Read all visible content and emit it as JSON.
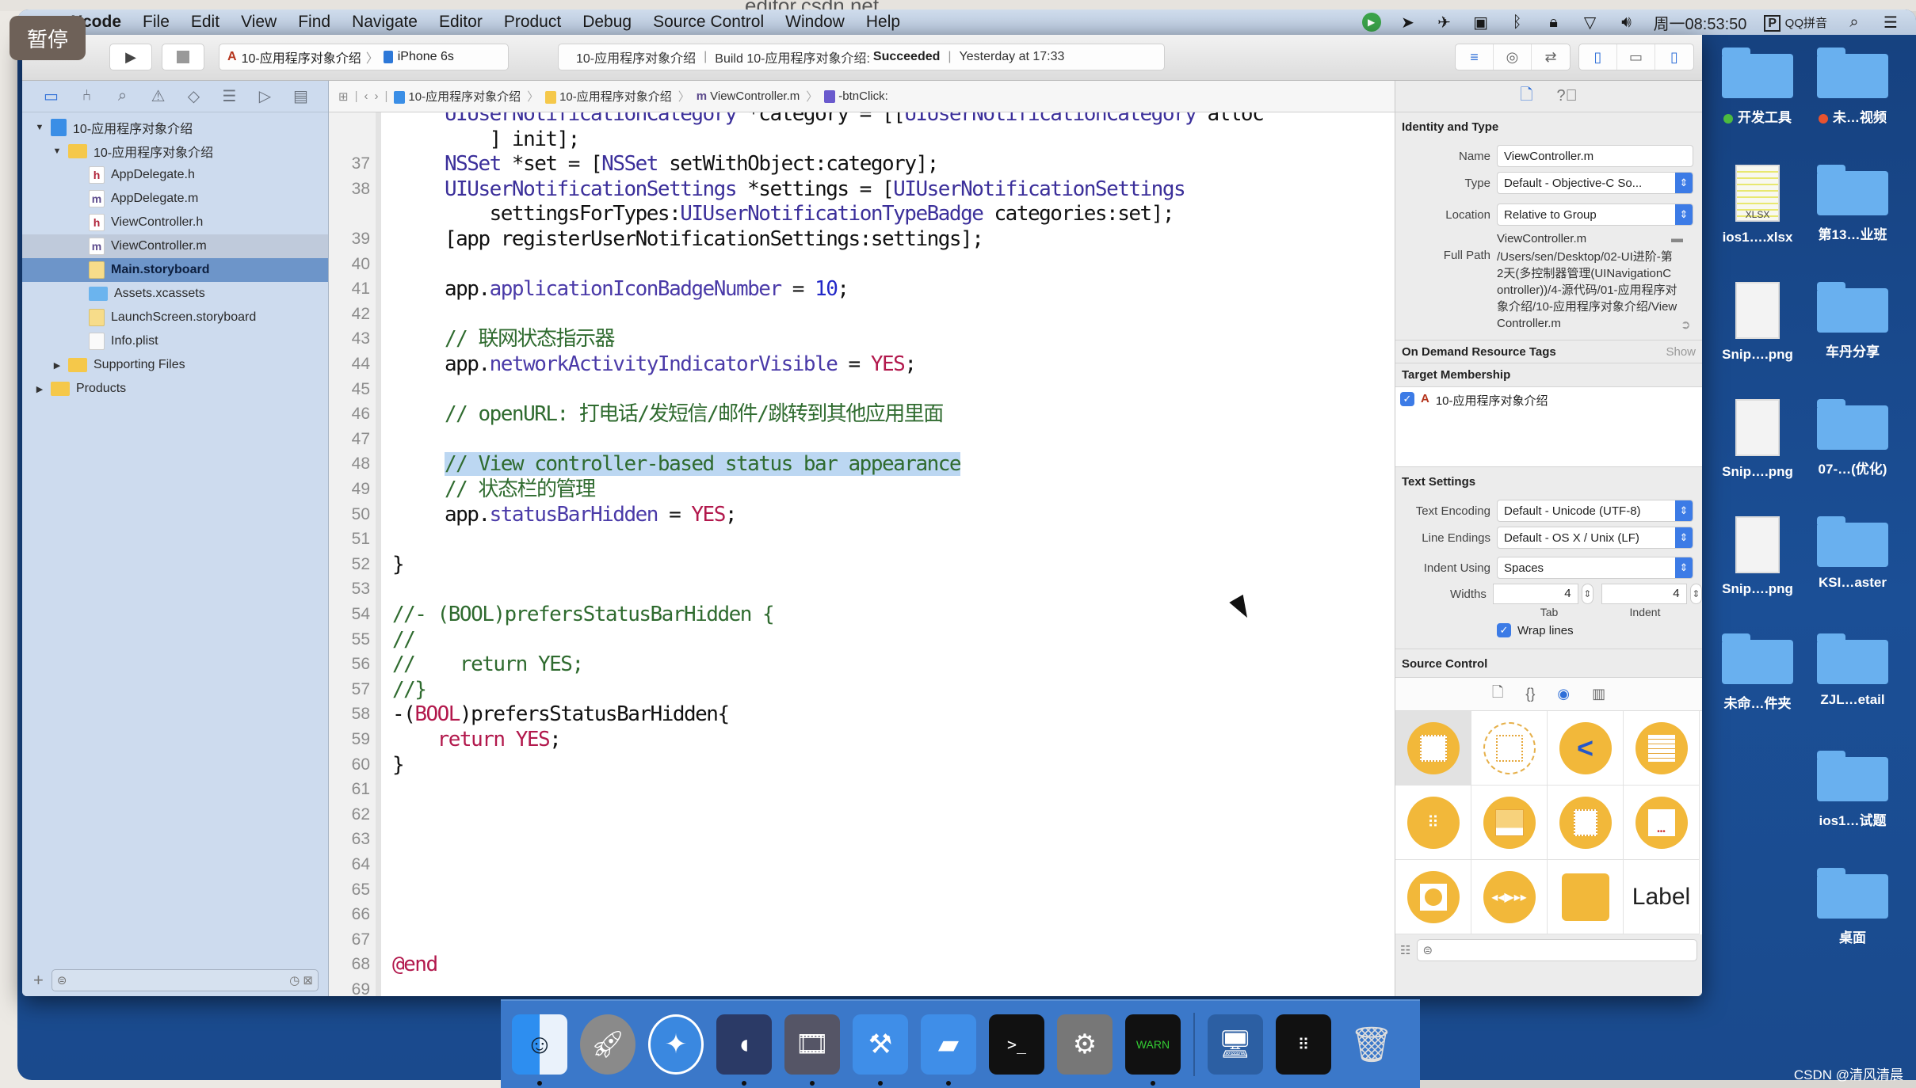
{
  "browser": {
    "url_fragment": "editor.csdn.net"
  },
  "menubar": {
    "app": "Xcode",
    "items": [
      "File",
      "Edit",
      "View",
      "Find",
      "Navigate",
      "Editor",
      "Product",
      "Debug",
      "Source Control",
      "Window",
      "Help"
    ],
    "clock": "周一08:53:50",
    "input_method": "QQ拼音",
    "status_icons": [
      "green-play-icon",
      "location-icon",
      "airplane-icon",
      "camera-icon",
      "bluetooth-icon",
      "lock-icon",
      "wifi-icon",
      "volume-icon"
    ]
  },
  "overlay": {
    "pause_label": "暂停"
  },
  "toolbar": {
    "scheme": "10-应用程序对象介绍",
    "device": "iPhone 6s",
    "activity": {
      "project": "10-应用程序对象介绍",
      "build_prefix": "Build 10-应用程序对象介绍:",
      "build_status": "Succeeded",
      "timestamp": "Yesterday at 17:33"
    }
  },
  "navigator": {
    "tree": [
      {
        "label": "10-应用程序对象介绍",
        "type": "project",
        "depth": 0,
        "expanded": true
      },
      {
        "label": "10-应用程序对象介绍",
        "type": "folder",
        "depth": 1,
        "expanded": true
      },
      {
        "label": "AppDelegate.h",
        "type": "h",
        "depth": 2
      },
      {
        "label": "AppDelegate.m",
        "type": "m",
        "depth": 2
      },
      {
        "label": "ViewController.h",
        "type": "h",
        "depth": 2
      },
      {
        "label": "ViewController.m",
        "type": "m",
        "depth": 2,
        "state": "subtle"
      },
      {
        "label": "Main.storyboard",
        "type": "storyboard",
        "depth": 2,
        "state": "selected"
      },
      {
        "label": "Assets.xcassets",
        "type": "assets",
        "depth": 2
      },
      {
        "label": "LaunchScreen.storyboard",
        "type": "storyboard",
        "depth": 2
      },
      {
        "label": "Info.plist",
        "type": "plist",
        "depth": 2
      },
      {
        "label": "Supporting Files",
        "type": "folder",
        "depth": 1,
        "expanded": false
      },
      {
        "label": "Products",
        "type": "folder",
        "depth": 0,
        "expanded": false
      }
    ]
  },
  "jumpbar": {
    "crumbs": [
      "10-应用程序对象介绍",
      "10-应用程序对象介绍",
      "ViewController.m",
      "-btnClick:"
    ]
  },
  "editor": {
    "lines": [
      {
        "n": "",
        "html": "<span class='k-cls'>UIUserNotificationCategory</span> *category = [[<span class='k-cls'>UIUserNotificationCategory</span> alloc"
      },
      {
        "n": "",
        "html": "    ] init];"
      },
      {
        "n": "37",
        "html": "<span class='k-cls'>NSSet</span> *set = [<span class='k-cls'>NSSet</span> setWithObject:category];"
      },
      {
        "n": "38",
        "html": "<span class='k-cls'>UIUserNotificationSettings</span> *settings = [<span class='k-cls'>UIUserNotificationSettings</span>"
      },
      {
        "n": "",
        "html": "    settingsForTypes:<span class='k-cls'>UIUserNotificationTypeBadge</span> categories:set];"
      },
      {
        "n": "39",
        "html": "[app registerUserNotificationSettings:settings];"
      },
      {
        "n": "40",
        "html": ""
      },
      {
        "n": "41",
        "html": "app.<span class='k-prop'>applicationIconBadgeNumber</span> = <span class='k-num'>10</span>;"
      },
      {
        "n": "42",
        "html": ""
      },
      {
        "n": "43",
        "html": "<span class='k-cm'>// 联网状态指示器</span>"
      },
      {
        "n": "44",
        "html": "app.<span class='k-prop'>networkActivityIndicatorVisible</span> = <span class='k-kw'>YES</span>;"
      },
      {
        "n": "45",
        "html": ""
      },
      {
        "n": "46",
        "html": "<span class='k-cm'>// openURL: 打电话/发短信/邮件/跳转到其他应用里面</span>"
      },
      {
        "n": "47",
        "html": ""
      },
      {
        "n": "48",
        "html": "<span class='k-cm hl'>// View controller-based status bar appearance</span>"
      },
      {
        "n": "49",
        "html": "<span class='k-cm'>// 状态栏的管理</span>"
      },
      {
        "n": "50",
        "html": "app.<span class='k-prop'>statusBarHidden</span> = <span class='k-kw'>YES</span>;"
      },
      {
        "n": "51",
        "html": ""
      },
      {
        "n": "52",
        "html": "}",
        "outdent": true
      },
      {
        "n": "53",
        "html": "",
        "outdent": true
      },
      {
        "n": "54",
        "html": "<span class='k-cm'>//- (BOOL)prefersStatusBarHidden {</span>",
        "outdent": true
      },
      {
        "n": "55",
        "html": "<span class='k-cm'>//</span>",
        "outdent": true
      },
      {
        "n": "56",
        "html": "<span class='k-cm'>//    return YES;</span>",
        "outdent": true
      },
      {
        "n": "57",
        "html": "<span class='k-cm'>//}</span>",
        "outdent": true
      },
      {
        "n": "58",
        "html": "-(<span class='k-kw'>BOOL</span>)prefersStatusBarHidden{",
        "outdent": true
      },
      {
        "n": "59",
        "html": "    <span class='k-kw'>return</span> <span class='k-kw'>YES</span>;",
        "outdent": true
      },
      {
        "n": "60",
        "html": "}",
        "outdent": true
      },
      {
        "n": "61",
        "html": "",
        "outdent": true
      },
      {
        "n": "62",
        "html": "",
        "outdent": true
      },
      {
        "n": "63",
        "html": "",
        "outdent": true
      },
      {
        "n": "64",
        "html": "",
        "outdent": true
      },
      {
        "n": "65",
        "html": "",
        "outdent": true
      },
      {
        "n": "66",
        "html": "",
        "outdent": true
      },
      {
        "n": "67",
        "html": "",
        "outdent": true
      },
      {
        "n": "68",
        "html": "<span class='k-kw'>@end</span>",
        "outdent": true
      },
      {
        "n": "69",
        "html": "",
        "outdent": true
      }
    ]
  },
  "inspector": {
    "identity": {
      "title": "Identity and Type",
      "name_label": "Name",
      "name_value": "ViewController.m",
      "type_label": "Type",
      "type_value": "Default - Objective-C So...",
      "location_label": "Location",
      "location_value": "Relative to Group",
      "location_file": "ViewController.m",
      "fullpath_label": "Full Path",
      "fullpath_value": "/Users/sen/Desktop/02-UI进阶-第2天(多控制器管理(UINavigationController))/4-源代码/01-应用程序对象介绍/10-应用程序对象介绍/ViewController.m"
    },
    "on_demand": {
      "title": "On Demand Resource Tags",
      "show": "Show"
    },
    "target": {
      "title": "Target Membership",
      "item": "10-应用程序对象介绍",
      "checked": true
    },
    "text_settings": {
      "title": "Text Settings",
      "encoding_label": "Text Encoding",
      "encoding_value": "Default - Unicode (UTF-8)",
      "endings_label": "Line Endings",
      "endings_value": "Default - OS X / Unix (LF)",
      "indent_label": "Indent Using",
      "indent_value": "Spaces",
      "widths_label": "Widths",
      "tab_value": "4",
      "indent_width_value": "4",
      "tab_caption": "Tab",
      "indent_caption": "Indent",
      "wrap_label": "Wrap lines",
      "wrap_checked": true
    },
    "source_control": {
      "title": "Source Control"
    },
    "library": {
      "items": [
        "view-icon",
        "container-view-icon",
        "navigation-back-icon",
        "table-view-icon",
        "collection-view-icon",
        "tab-bar-controller-icon",
        "page-view-icon",
        "page-control-icon",
        "gl-kit-icon",
        "av-player-icon",
        "object-cube-icon",
        "label-item"
      ],
      "label_text": "Label"
    }
  },
  "desktop": {
    "icons": [
      {
        "name": "开发工具",
        "kind": "folder",
        "tag": "#4cbb3f"
      },
      {
        "name": "未…视频",
        "kind": "folder",
        "tag": "#e8532f"
      },
      {
        "name": "ios1….xlsx",
        "kind": "xlsx"
      },
      {
        "name": "第13…业班",
        "kind": "folder"
      },
      {
        "name": "Snip….png",
        "kind": "image"
      },
      {
        "name": "车丹分享",
        "kind": "folder"
      },
      {
        "name": "Snip….png",
        "kind": "image"
      },
      {
        "name": "07-…(优化)",
        "kind": "folder"
      },
      {
        "name": "Snip….png",
        "kind": "image"
      },
      {
        "name": "KSI…aster",
        "kind": "folder"
      },
      {
        "name": "未命…件夹",
        "kind": "folder"
      },
      {
        "name": "ZJL…etail",
        "kind": "folder"
      },
      {
        "name": "ios1…试题",
        "kind": "folder"
      },
      {
        "name": "桌面",
        "kind": "folder"
      }
    ]
  },
  "dock": {
    "apps": [
      {
        "name": "finder",
        "running": true
      },
      {
        "name": "launchpad",
        "running": false
      },
      {
        "name": "safari",
        "running": false
      },
      {
        "name": "mouse-app",
        "running": true
      },
      {
        "name": "photo-slideshow",
        "running": true
      },
      {
        "name": "xcode",
        "running": true
      },
      {
        "name": "instruments",
        "running": true
      },
      {
        "name": "terminal",
        "running": false
      },
      {
        "name": "system-preferences",
        "running": false
      },
      {
        "name": "console",
        "running": true
      }
    ],
    "extras": [
      "screen-sharing",
      "downloads-stack",
      "trash"
    ]
  },
  "watermark": "CSDN @清风清晨"
}
